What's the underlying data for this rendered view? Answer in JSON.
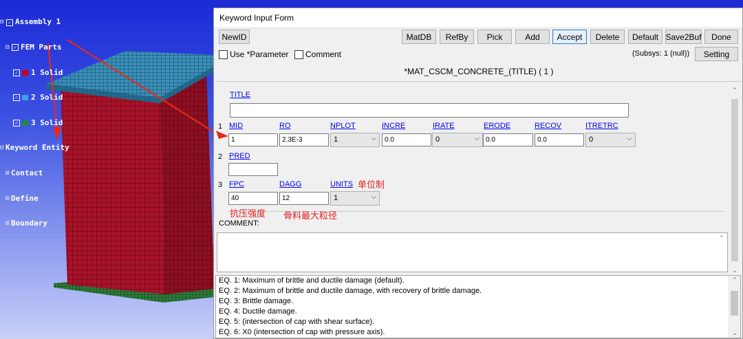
{
  "tree": {
    "assembly": "Assembly 1",
    "fem_parts": "FEM Parts",
    "parts": [
      {
        "label": "1 Solid",
        "color": "#c80018"
      },
      {
        "label": "2 Solid",
        "color": "#3aa4e6"
      },
      {
        "label": "3 Solid",
        "color": "#1f8a3a"
      }
    ],
    "keyword_entity": "Keyword Entity",
    "contact": "Contact",
    "define": "Define",
    "boundary": "Boundary"
  },
  "dialog": {
    "title": "Keyword Input Form",
    "buttons": {
      "newid": "NewID",
      "matdb": "MatDB",
      "refby": "RefBy",
      "pick": "Pick",
      "add": "Add",
      "accept": "Accept",
      "delete": "Delete",
      "default": "Default",
      "save2buf": "Save2Buf",
      "done": "Done",
      "setting": "Setting"
    },
    "use_parameter": "Use *Parameter",
    "comment_check": "Comment",
    "subsys": "(Subsys: 1 (null))",
    "keyword": "*MAT_CSCM_CONCRETE_(TITLE)    ( 1 )",
    "fields": {
      "title_label": "TITLE",
      "row_numbers": [
        "1",
        "2",
        "3"
      ],
      "row1": {
        "mid": {
          "label": "MID",
          "value": "1"
        },
        "ro": {
          "label": "RO",
          "value": "2.3E-3"
        },
        "nplot": {
          "label": "NPLOT",
          "value": "1"
        },
        "incre": {
          "label": "INCRE",
          "value": "0.0"
        },
        "irate": {
          "label": "IRATE",
          "value": "0"
        },
        "erode": {
          "label": "ERODE",
          "value": "0.0"
        },
        "recov": {
          "label": "RECOV",
          "value": "0.0"
        },
        "itretrc": {
          "label": "ITRETRC",
          "value": "0"
        }
      },
      "row2": {
        "pred": {
          "label": "PRED",
          "value": ""
        }
      },
      "row3": {
        "fpc": {
          "label": "FPC",
          "value": "40"
        },
        "dagg": {
          "label": "DAGG",
          "value": "12"
        },
        "units": {
          "label": "UNITS",
          "value": "1"
        }
      }
    },
    "annotations": {
      "units_note": "单位制",
      "fpc_note": "抗压强度",
      "dagg_note": "骨料最大粒径",
      "annotation_color": "#e22020"
    },
    "comment_label": "COMMENT:",
    "help_lines": [
      "EQ. 1: Maximum of brittle and ductile damage (default).",
      "EQ. 2: Maximum of brittle and ductile damage, with recovery of  brittle damage.",
      "EQ. 3: Brittle damage.",
      "EQ. 4: Ductile damage.",
      "EQ. 5: (intersection of cap with shear surface).",
      "EQ. 6: X0 (intersection of cap with pressure axis)."
    ]
  }
}
